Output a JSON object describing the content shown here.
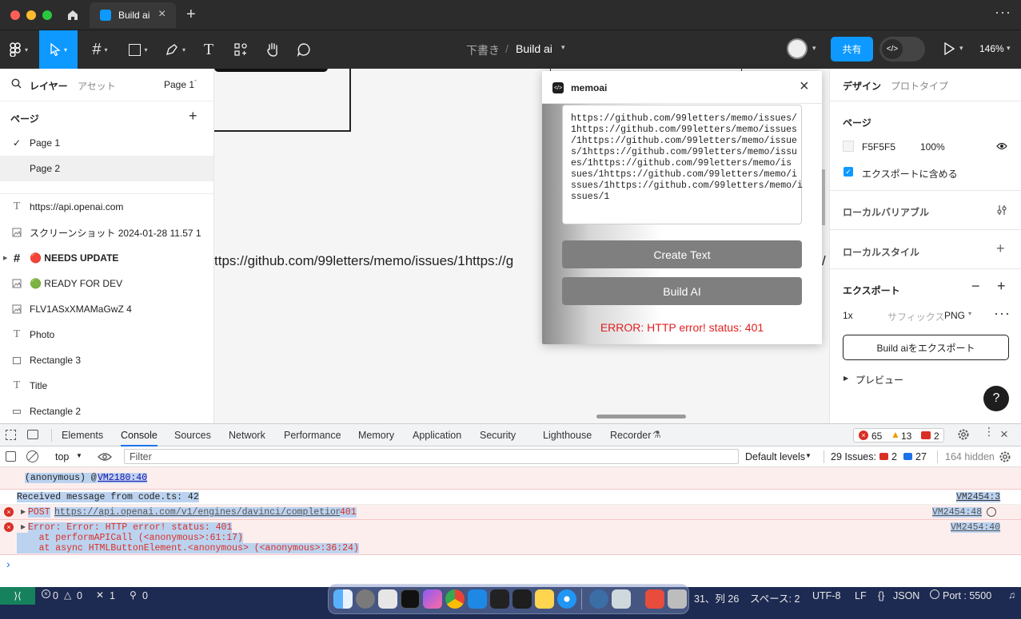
{
  "browser": {
    "tab_title": "Build ai"
  },
  "toolbar": {
    "breadcrumb_draft": "下書き",
    "breadcrumb_sep": "/",
    "file_name": "Build ai",
    "share_label": "共有",
    "zoom": "146%"
  },
  "left_panel": {
    "tab_layers": "レイヤー",
    "tab_assets": "アセット",
    "page_selector": "Page 1",
    "pages_title": "ページ",
    "pages": [
      {
        "label": "Page 1",
        "check": "✓"
      },
      {
        "label": "Page 2",
        "check": ""
      }
    ],
    "layers": [
      {
        "label": "https://api.openai.com",
        "icon": "text-icon"
      },
      {
        "label": "スクリーンショット 2024-01-28 11.57 1",
        "icon": "image-icon"
      },
      {
        "label": "🔴 NEEDS UPDATE",
        "icon": "frame-icon"
      },
      {
        "label": "🟢 READY FOR DEV",
        "icon": "image-icon"
      },
      {
        "label": "FLV1ASxXMAMaGwZ 4",
        "icon": "image-icon"
      },
      {
        "label": "Photo",
        "icon": "text-icon"
      },
      {
        "label": "Rectangle 3",
        "icon": "rectangle-icon"
      },
      {
        "label": "Title",
        "icon": "text-icon"
      },
      {
        "label": "Rectangle 2",
        "icon": "rectangle-icon"
      }
    ]
  },
  "canvas": {
    "url_text": "ttps://github.com/99letters/memo/issues/1https://g",
    "url_text_right": "/"
  },
  "plugin": {
    "title": "memoai",
    "textarea_lines": [
      "https://github.com/99letters/memo/issues/",
      "1https://github.com/99letters/memo/issues",
      "/1https://github.com/99letters/memo/issue",
      "s/1https://github.com/99letters/memo/issu",
      "es/1https://github.com/99letters/memo/is",
      "sues/1https://github.com/99letters/memo/i",
      "ssues/1https://github.com/99letters/memo/i",
      "ssues/1"
    ],
    "create_text_label": "Create Text",
    "build_ai_label": "Build AI",
    "error_text": "ERROR: HTTP error! status: 401"
  },
  "right_panel": {
    "tab_design": "デザイン",
    "tab_prototype": "プロトタイプ",
    "page_title": "ページ",
    "page_color": "F5F5F5",
    "page_opacity": "100%",
    "include_export": "エクスポートに含める",
    "local_variables": "ローカルバリアブル",
    "local_styles": "ローカルスタイル",
    "export_title": "エクスポート",
    "export_scale": "1x",
    "export_suffix_placeholder": "サフィックス",
    "export_format": "PNG",
    "export_button": "Build aiをエクスポート",
    "preview": "プレビュー",
    "help": "?"
  },
  "devtools": {
    "tabs": [
      "Elements",
      "Console",
      "Sources",
      "Network",
      "Performance",
      "Memory",
      "Application",
      "Security",
      "Lighthouse",
      "Recorder"
    ],
    "errors": "65",
    "warnings": "13",
    "issues_badge": "2",
    "context": "top",
    "filter_placeholder": "Filter",
    "levels": "Default levels",
    "issues_label": "29 Issues:",
    "issues_err": "2",
    "issues_info": "27",
    "hidden": "164 hidden",
    "log": {
      "anon": "(anonymous) @",
      "anon_link": "VM2180:40",
      "msg": "Received message from code.ts: 42",
      "msg_src": "VM2454:3",
      "post_prefix": "POST",
      "post_url": "https://api.openai.com/v1/engines/davinci/completions",
      "post_status": "401",
      "post_src": "VM2454:48",
      "err1": "Error: Error: HTTP error! status: 401",
      "err2": "    at performAPICall (<anonymous>:61:17)",
      "err3": "    at async HTMLButtonElement.<anonymous> (<anonymous>:36:24)",
      "err_src": "VM2454:40",
      "prompt": "›"
    }
  },
  "statusbar": {
    "problems_err": "0",
    "problems_warn": "0",
    "tools": "1",
    "ports": "0",
    "position": "31、列 26",
    "spaces": "スペース: 2",
    "encoding": "UTF-8",
    "eol": "LF",
    "lang": "JSON",
    "port": "Port : 5500"
  }
}
